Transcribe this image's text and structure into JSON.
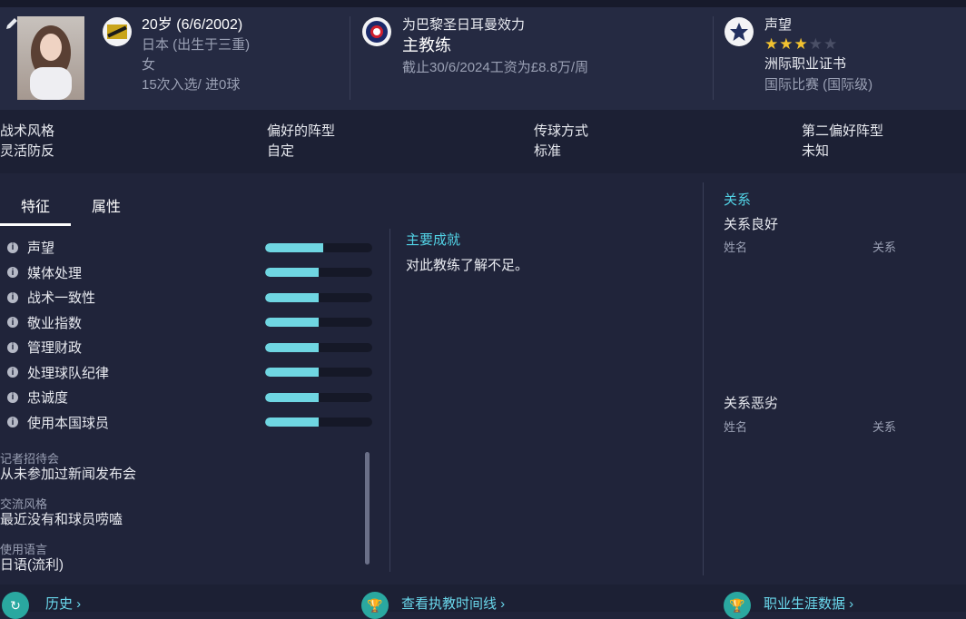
{
  "profile": {
    "age_dob": "20岁 (6/6/2002)",
    "nationality": "日本 (出生于三重)",
    "gender": "女",
    "caps": "15次入选/ 进0球"
  },
  "club": {
    "label": "为巴黎圣日耳曼效力",
    "role": "主教练",
    "contract": "截止30/6/2024工资为£8.8万/周"
  },
  "reputation": {
    "label": "声望",
    "stars_filled": 3,
    "stars_total": 5,
    "licence": "洲际职业证书",
    "level": "国际比赛 (国际级)"
  },
  "tactics": [
    {
      "label": "战术风格",
      "value": "灵活防反"
    },
    {
      "label": "偏好的阵型",
      "value": "自定"
    },
    {
      "label": "传球方式",
      "value": "标准"
    },
    {
      "label": "第二偏好阵型",
      "value": "未知"
    }
  ],
  "tabs": {
    "traits": "特征",
    "attributes": "属性"
  },
  "attributes": [
    {
      "label": "声望",
      "fill": 0.54
    },
    {
      "label": "媒体处理",
      "fill": 0.5
    },
    {
      "label": "战术一致性",
      "fill": 0.5
    },
    {
      "label": "敬业指数",
      "fill": 0.5
    },
    {
      "label": "管理财政",
      "fill": 0.5
    },
    {
      "label": "处理球队纪律",
      "fill": 0.5
    },
    {
      "label": "忠诚度",
      "fill": 0.5
    },
    {
      "label": "使用本国球员",
      "fill": 0.5
    }
  ],
  "info": [
    {
      "label": "记者招待会",
      "value": "从未参加过新闻发布会"
    },
    {
      "label": "交流风格",
      "value": "最近没有和球员唠嗑"
    },
    {
      "label": "使用语言",
      "value": "日语(流利)"
    }
  ],
  "achievements": {
    "title": "主要成就",
    "text": "对此教练了解不足。"
  },
  "relations": {
    "title": "关系",
    "good": {
      "title": "关系良好",
      "col_name": "姓名",
      "col_rel": "关系"
    },
    "bad": {
      "title": "关系恶劣",
      "col_name": "姓名",
      "col_rel": "关系"
    }
  },
  "footer": {
    "history": "历史",
    "timeline": "查看执教时间线",
    "career": "职业生涯数据"
  },
  "colors": {
    "accent": "#52d3e6",
    "bar": "#6fd6e2",
    "star": "#f2c230"
  }
}
